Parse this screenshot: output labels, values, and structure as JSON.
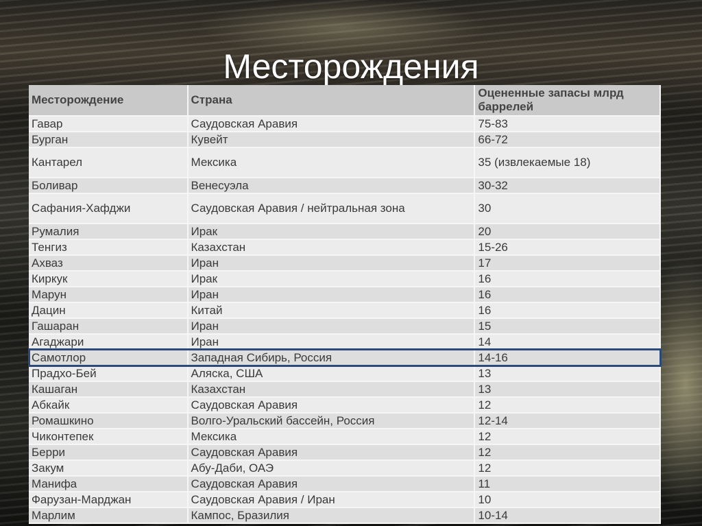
{
  "title": "Месторождения",
  "table": {
    "headers": [
      "Месторождение",
      "Страна",
      "Оцененные запасы млрд баррелей"
    ],
    "rows": [
      [
        "Гавар",
        "Саудовская Аравия",
        "75-83"
      ],
      [
        "Бурган",
        "Кувейт",
        "66-72"
      ],
      [
        "Кантарел",
        "Мексика",
        "35 (извлекаемые 18)"
      ],
      [
        "Боливар",
        "Венесуэла",
        "30-32"
      ],
      [
        "Сафания-Хафджи",
        "Саудовская Аравия / нейтральная зона",
        "30"
      ],
      [
        "Румалия",
        "Ирак",
        "20"
      ],
      [
        "Тенгиз",
        "Казахстан",
        "15-26"
      ],
      [
        "Ахваз",
        "Иран",
        "17"
      ],
      [
        "Киркук",
        "Ирак",
        "16"
      ],
      [
        "Марун",
        "Иран",
        "16"
      ],
      [
        "Дацин",
        "Китай",
        "16"
      ],
      [
        "Гашаран",
        "Иран",
        "15"
      ],
      [
        "Агаджари",
        "Иран",
        "14"
      ],
      [
        "Самотлор",
        "Западная Сибирь, Россия",
        "14-16"
      ],
      [
        "Прадхо-Бей",
        "Аляска, США",
        "13"
      ],
      [
        "Кашаган",
        "Казахстан",
        "13"
      ],
      [
        "Абкайк",
        "Саудовская Аравия",
        "12"
      ],
      [
        "Ромашкино",
        "Волго-Уральский бассейн, Россия",
        "12-14"
      ],
      [
        "Чиконтепек",
        "Мексика",
        "12"
      ],
      [
        "Берри",
        "Саудовская Аравия",
        "12"
      ],
      [
        "Закум",
        "Абу-Даби, ОАЭ",
        "12"
      ],
      [
        "Манифа",
        "Саудовская Аравия",
        "11"
      ],
      [
        "Фарузан-Марджан",
        "Саудовская Аравия / Иран",
        "10"
      ],
      [
        "Марлим",
        "Кампос, Бразилия",
        "10-14"
      ]
    ],
    "highlighted_row": 13,
    "highlight_color": "#2b4a78"
  }
}
